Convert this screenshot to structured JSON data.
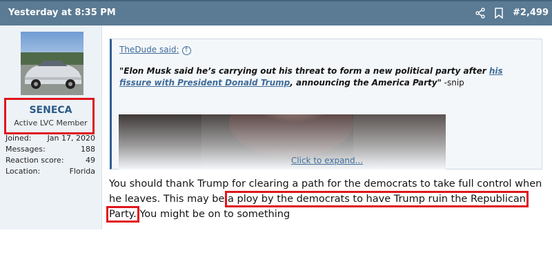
{
  "post": {
    "date": "Yesterday at 8:35 PM",
    "number": "#2,499",
    "icons": {
      "share": "share-icon",
      "bookmark": "bookmark-icon"
    }
  },
  "user": {
    "name": "SENECA",
    "title": "Active LVC Member",
    "stats": [
      {
        "label": "Joined:",
        "value": "Jan 17, 2020"
      },
      {
        "label": "Messages:",
        "value": "188"
      },
      {
        "label": "Reaction score:",
        "value": "49"
      },
      {
        "label": "Location:",
        "value": "Florida"
      }
    ]
  },
  "quote": {
    "author": "TheDude said:",
    "text_before": "\"Elon Musk said he’s carrying out his threat to form a new political party after ",
    "link_text": "his fissure with President Donald Trump",
    "text_after": ", announcing the America Party\"",
    "snip": " -snip",
    "expand_label": "Click to expand..."
  },
  "message": {
    "part1": "You should thank Trump for clearing a path for the democrats to take full control when he leaves. This may be",
    "highlight": "a ploy by the democrats to have Trump ruin the Republican Party.",
    "part2": " You might be on to something"
  },
  "colors": {
    "header": "#5b7a93",
    "sidebar": "#edf2f7",
    "link": "#3f6c99",
    "highlight_box": "#e0151b"
  }
}
